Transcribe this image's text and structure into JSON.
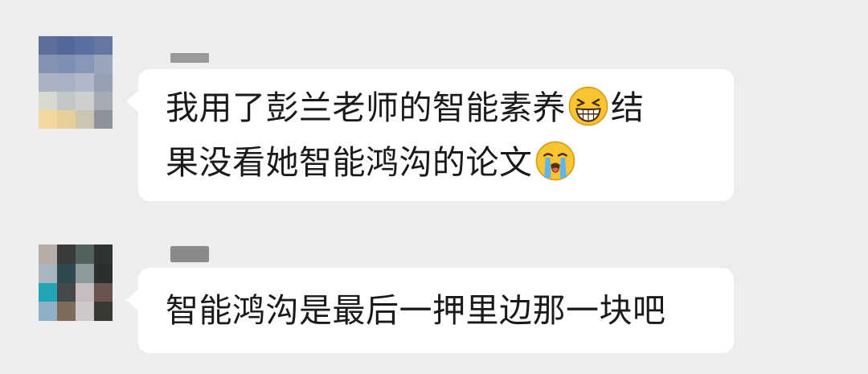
{
  "chat": {
    "messages": [
      {
        "line1": "我用了彭兰老师的智能素养",
        "emoji1": "grinning-squinting-face-icon",
        "line1_tail": "结",
        "line2": "果没看她智能鸿沟的论文",
        "emoji2": "loudly-crying-face-icon"
      },
      {
        "line1": "智能鸿沟是最后一押里边那一块吧"
      }
    ]
  },
  "colors": {
    "background": "#ededed",
    "bubble": "#ffffff",
    "text": "#1a1a1a",
    "emoji_yellow": "#f7c533"
  }
}
